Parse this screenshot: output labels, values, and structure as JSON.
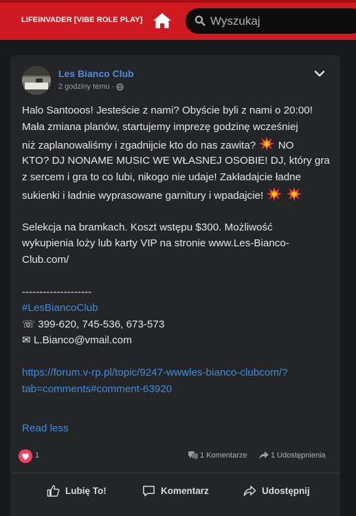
{
  "header": {
    "brand": "LIFEINVADER [VIBE ROLE PLAY]",
    "search_placeholder": "Wyszukaj"
  },
  "post": {
    "author": "Les Bianco Club",
    "time": "2 godziny temu",
    "visibility_icon": "globe-icon",
    "body": {
      "p1": [
        "Halo Santooos! Jesteście z nami? Obyście byli z nami o 20:00!",
        "Mała zmiana planów, startujemy imprezę godzinę wcześniej",
        "niż zaplanowaliśmy i zgadnijcie kto do nas zawita?",
        "NO",
        "KTO? DJ NONAME MUSIC WE WŁASNEJ OSOBIE! DJ, który gra",
        "z sercem i gra to co lubi, nikogo nie udaje! Zakładajcie ładne",
        "sukienki i ładnie wyprasowane garnitury i wpadajcie!"
      ],
      "p2": [
        "Selekcja na bramkach. Koszt wstępu $300. Możliwość",
        "wykupienia loży lub karty VIP na stronie www.Les-Bianco-",
        "Club.com/"
      ],
      "separator": "--------------------",
      "hashtag": "#LesBiancoClub",
      "phone_icon": "☏",
      "phones": "399-620, 745-536, 673-573",
      "mail_icon": "✉",
      "email": "L.Bianco@vmail.com",
      "link_lines": [
        "https://forum.v-rp.pl/topic/9247-wwwles-bianco-clubcom/?",
        "tab=comments#comment-63920"
      ],
      "emoji": "collision-emoji"
    },
    "read_less": "Read less",
    "reactions": {
      "heart_count": "1",
      "comments": "1 Komentarze",
      "shares": "1 Udostępnienia"
    },
    "actions": {
      "like": "Lubię To!",
      "comment": "Komentarz",
      "share": "Udostępnij"
    }
  },
  "colors": {
    "topbar": "#ce1a20",
    "background": "#18191a",
    "card": "#242526",
    "link": "#3f8ddc",
    "author": "#4c8ee6",
    "heart": "#f3425f"
  }
}
